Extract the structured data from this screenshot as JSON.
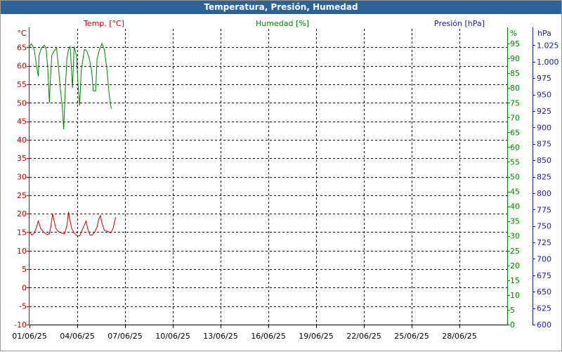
{
  "window": {
    "title": "Temperatura, Presión, Humedad"
  },
  "colors": {
    "temperature": "#c00000",
    "humidity": "#008000",
    "pressure": "#1a1aa0",
    "grid": "#000000",
    "xaxis": "#000000",
    "titlebar": "#2d6297"
  },
  "chart_data": {
    "type": "line",
    "grid": true,
    "x_axis": {
      "range": [
        "01/06/25",
        "01/07/25"
      ],
      "tick_labels": [
        "01/06/25",
        "04/06/25",
        "07/06/25",
        "10/06/25",
        "13/06/25",
        "16/06/25",
        "19/06/25",
        "22/06/25",
        "25/06/25",
        "28/06/25"
      ]
    },
    "axes": {
      "temperature": {
        "title": "Temp. [°C]",
        "unit": "°C",
        "ylim": [
          -10,
          70
        ],
        "ticks": [
          "65",
          "60",
          "55",
          "50",
          "45",
          "40",
          "35",
          "30",
          "25",
          "20",
          "15",
          "10",
          "5",
          "0",
          "-5",
          "-10"
        ]
      },
      "humidity": {
        "title": "Humedad [%]",
        "unit": "%",
        "ylim": [
          0,
          100
        ],
        "ticks": [
          "95",
          "90",
          "85",
          "80",
          "75",
          "70",
          "65",
          "60",
          "55",
          "50",
          "45",
          "40",
          "35",
          "30",
          "25",
          "20",
          "15",
          "10",
          "5",
          "0"
        ]
      },
      "pressure": {
        "title": "Presión [hPa]",
        "unit": "hPa",
        "ylim": [
          600,
          1050
        ],
        "ticks": [
          "1.025",
          "1.000",
          "975",
          "950",
          "925",
          "900",
          "875",
          "850",
          "825",
          "800",
          "775",
          "750",
          "725",
          "700",
          "675",
          "650",
          "625",
          "600"
        ]
      }
    },
    "series": [
      {
        "name": "Temp. [°C]",
        "axis": "temperature",
        "points": [
          [
            0.0,
            15.0
          ],
          [
            0.15,
            14.2
          ],
          [
            0.3,
            14.8
          ],
          [
            0.45,
            16.5
          ],
          [
            0.55,
            18.0
          ],
          [
            0.7,
            16.0
          ],
          [
            0.9,
            15.0
          ],
          [
            1.1,
            14.3
          ],
          [
            1.25,
            14.6
          ],
          [
            1.35,
            16.8
          ],
          [
            1.45,
            20.0
          ],
          [
            1.55,
            18.0
          ],
          [
            1.65,
            16.0
          ],
          [
            1.8,
            15.2
          ],
          [
            2.0,
            14.8
          ],
          [
            2.2,
            14.5
          ],
          [
            2.35,
            16.8
          ],
          [
            2.45,
            20.5
          ],
          [
            2.55,
            18.0
          ],
          [
            2.65,
            16.0
          ],
          [
            2.8,
            14.8
          ],
          [
            3.0,
            14.0
          ],
          [
            3.15,
            14.0
          ],
          [
            3.3,
            15.5
          ],
          [
            3.45,
            17.0
          ],
          [
            3.55,
            18.0
          ],
          [
            3.65,
            16.0
          ],
          [
            3.8,
            14.2
          ],
          [
            3.95,
            14.3
          ],
          [
            4.1,
            15.0
          ],
          [
            4.25,
            16.5
          ],
          [
            4.35,
            18.5
          ],
          [
            4.45,
            19.5
          ],
          [
            4.55,
            17.5
          ],
          [
            4.7,
            15.5
          ],
          [
            4.9,
            15.2
          ],
          [
            5.1,
            14.8
          ],
          [
            5.25,
            16.0
          ],
          [
            5.4,
            19.0
          ]
        ]
      },
      {
        "name": "Humedad [%]",
        "axis": "humidity",
        "points": [
          [
            0.0,
            94.0
          ],
          [
            0.12,
            95.0
          ],
          [
            0.3,
            93.0
          ],
          [
            0.45,
            87.0
          ],
          [
            0.55,
            84.0
          ],
          [
            0.6,
            91.0
          ],
          [
            0.75,
            93.5
          ],
          [
            0.95,
            94.5
          ],
          [
            1.05,
            93.0
          ],
          [
            1.15,
            86.0
          ],
          [
            1.25,
            75.0
          ],
          [
            1.3,
            82.0
          ],
          [
            1.4,
            91.0
          ],
          [
            1.55,
            92.5
          ],
          [
            1.7,
            93.5
          ],
          [
            1.8,
            88.0
          ],
          [
            1.95,
            79.0
          ],
          [
            2.05,
            74.0
          ],
          [
            2.15,
            66.0
          ],
          [
            2.25,
            80.0
          ],
          [
            2.35,
            90.0
          ],
          [
            2.45,
            93.0
          ],
          [
            2.55,
            94.0
          ],
          [
            2.6,
            90.0
          ],
          [
            2.7,
            80.0
          ],
          [
            2.8,
            94.0
          ],
          [
            2.95,
            91.0
          ],
          [
            3.05,
            81.0
          ],
          [
            3.15,
            74.0
          ],
          [
            3.25,
            86.0
          ],
          [
            3.45,
            93.0
          ],
          [
            3.6,
            92.5
          ],
          [
            3.75,
            90.0
          ],
          [
            3.9,
            86.0
          ],
          [
            4.0,
            79.0
          ],
          [
            4.15,
            79.0
          ],
          [
            4.25,
            90.0
          ],
          [
            4.4,
            93.0
          ],
          [
            4.55,
            95.0
          ],
          [
            4.7,
            93.0
          ],
          [
            4.85,
            87.0
          ],
          [
            5.0,
            78.0
          ],
          [
            5.1,
            74.0
          ],
          [
            5.15,
            73.0
          ]
        ]
      }
    ]
  }
}
